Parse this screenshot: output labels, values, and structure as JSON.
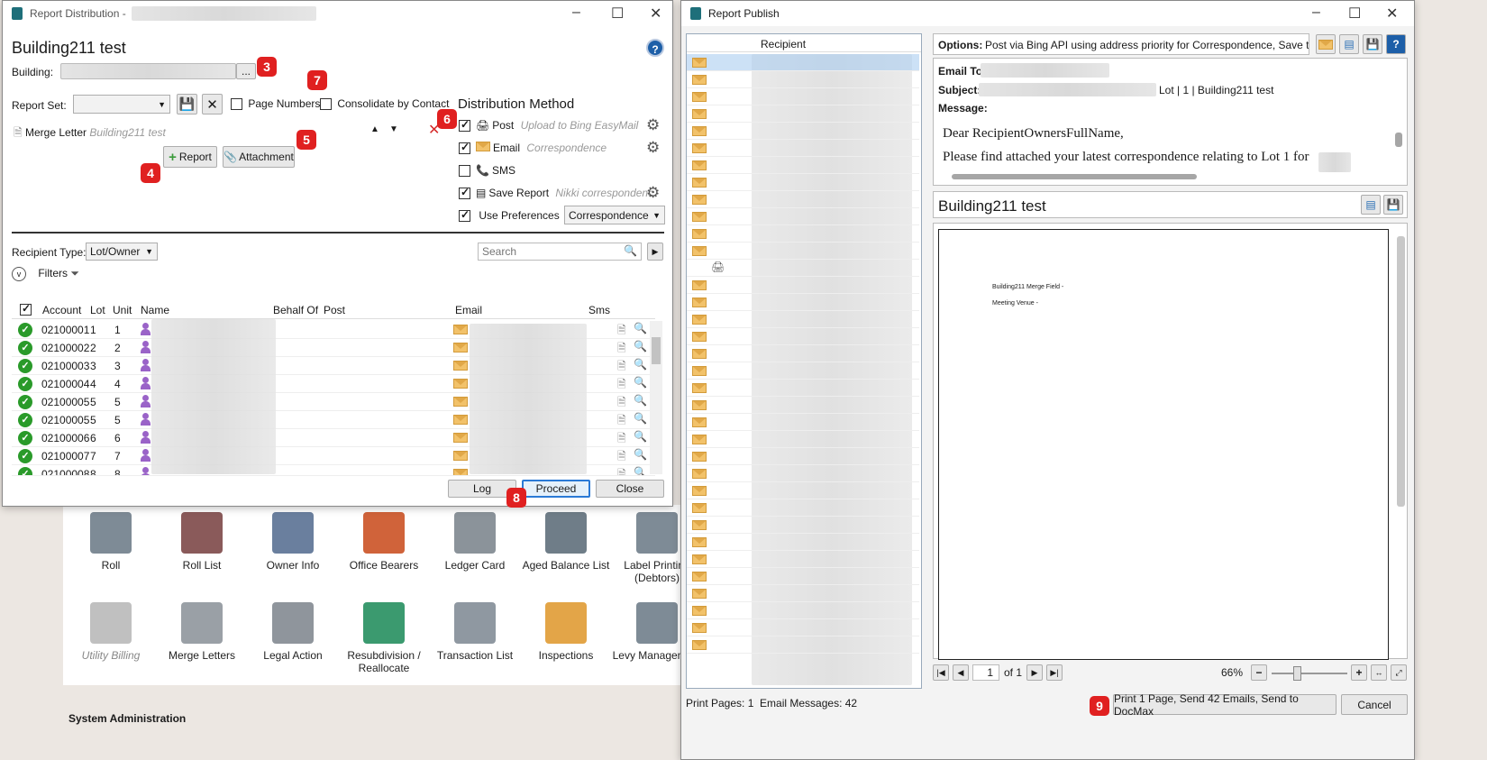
{
  "background_app": {
    "tiles_row1": [
      {
        "label": "Roll"
      },
      {
        "label": "Roll List"
      },
      {
        "label": "Owner Info"
      },
      {
        "label": "Office Bearers"
      },
      {
        "label": "Ledger Card"
      },
      {
        "label": "Aged Balance List"
      },
      {
        "label": "Label Printing (Debtors)"
      }
    ],
    "tiles_row2": [
      {
        "label": "Utility Billing"
      },
      {
        "label": "Merge Letters"
      },
      {
        "label": "Legal Action"
      },
      {
        "label": "Resubdivision / Reallocate"
      },
      {
        "label": "Transaction List"
      },
      {
        "label": "Inspections"
      },
      {
        "label": "Levy Management"
      }
    ],
    "section_title": "System Administration"
  },
  "report_distribution": {
    "window_title": "Report Distribution -",
    "heading": "Building211 test",
    "help": "?",
    "building_label": "Building:",
    "browse_button": "...",
    "report_set_label": "Report Set:",
    "page_numbers_label": "Page Numbers",
    "consolidate_label": "Consolidate by Contact",
    "report_item_name": "Merge Letter",
    "report_item_building": "Building211 test",
    "add_report_button": "Report",
    "attachment_button": "Attachment",
    "distribution_heading": "Distribution Method",
    "methods": [
      {
        "label": "Post",
        "detail": "Upload to Bing EasyMail",
        "checked": true
      },
      {
        "label": "Email",
        "detail": "Correspondence",
        "checked": true
      },
      {
        "label": "SMS",
        "detail": "",
        "checked": false
      },
      {
        "label": "Save Report",
        "detail": "Nikki correspondenc",
        "checked": true
      }
    ],
    "use_preferences_label": "Use Preferences",
    "use_preferences_value": "Correspondence",
    "recipient_type_label": "Recipient Type:",
    "recipient_type_value": "Lot/Owner",
    "search_placeholder": "Search",
    "filters_label": "Filters",
    "columns": [
      "Account",
      "Lot",
      "Unit",
      "Name",
      "Behalf Of",
      "Post",
      "Email",
      "Sms"
    ],
    "rows": [
      {
        "account": "02100001",
        "lot": "1",
        "unit": "1"
      },
      {
        "account": "02100002",
        "lot": "2",
        "unit": "2"
      },
      {
        "account": "02100003",
        "lot": "3",
        "unit": "3"
      },
      {
        "account": "02100004",
        "lot": "4",
        "unit": "4"
      },
      {
        "account": "02100005",
        "lot": "5",
        "unit": "5"
      },
      {
        "account": "02100005",
        "lot": "5",
        "unit": "5"
      },
      {
        "account": "02100006",
        "lot": "6",
        "unit": "6"
      },
      {
        "account": "02100007",
        "lot": "7",
        "unit": "7"
      },
      {
        "account": "02100008",
        "lot": "8",
        "unit": "8"
      }
    ],
    "log_button": "Log",
    "proceed_button": "Proceed",
    "close_button": "Close",
    "badges": [
      "3",
      "4",
      "5",
      "6",
      "7",
      "8"
    ]
  },
  "report_publish": {
    "window_title": "Report Publish",
    "recipient_header": "Recipient",
    "options_label": "Options:",
    "options_value": "Post via Bing API using address priority for Correspondence, Save to Doc",
    "email_to_label": "Email To:",
    "subject_label": "Subject:",
    "subject_value": "Lot | 1 | Building211 test",
    "message_label": "Message:",
    "message_line1": "Dear RecipientOwnersFullName,",
    "message_line2": "Please find attached your latest correspondence relating to Lot 1 for",
    "preview_title": "Building211 test",
    "preview_line1": "Building211 Merge Field -",
    "preview_line2": "Meeting Venue -",
    "page_current": "1",
    "page_of": "of 1",
    "zoom": "66%",
    "status_text": "Print Pages: 1  Email Messages: 42",
    "action_button": "Print 1 Page,  Send 42 Emails,  Send to DocMax",
    "cancel_button": "Cancel",
    "badge": "9"
  }
}
